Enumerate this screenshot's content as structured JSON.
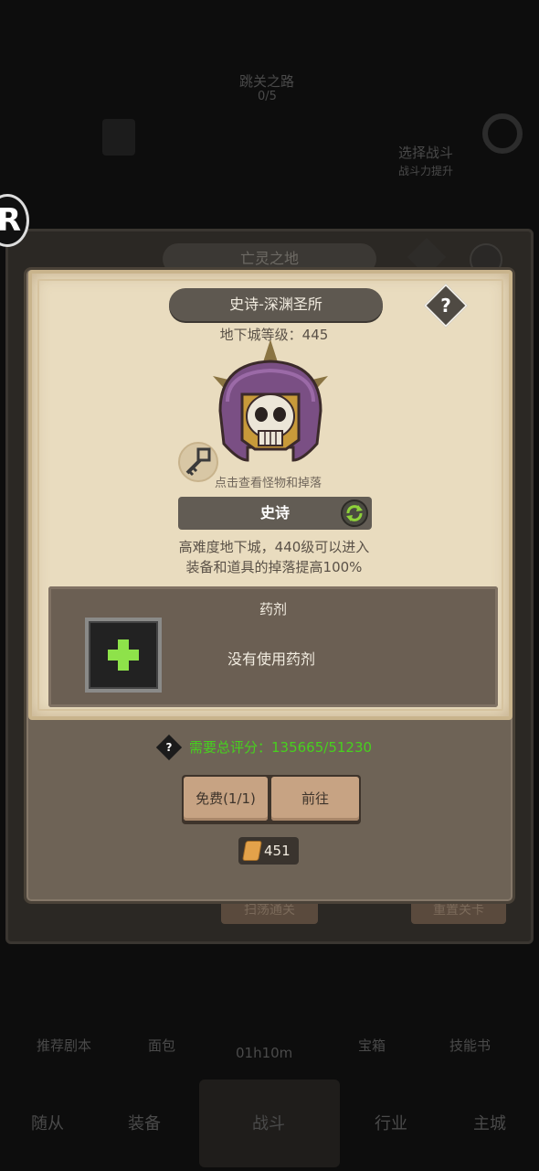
{
  "background": {
    "top_label": "跳关之路",
    "top_count": "0/5",
    "right_label": "选择战斗",
    "right_sub": "战斗力提升",
    "behind_title": "亡灵之地",
    "behind_btn_left": "扫荡通关",
    "behind_btn_right": "重置关卡",
    "timer": "01h10m",
    "nav": [
      "推荐剧本",
      "面包",
      "宝箱",
      "技能书"
    ],
    "tabs": [
      "随从",
      "装备",
      "战斗",
      "行业",
      "主城"
    ],
    "badge": "R"
  },
  "dialog": {
    "title": "史诗-深渊圣所",
    "help_label": "?",
    "level_text": "地下城等级：445",
    "monster_hint": "点击查看怪物和掉落",
    "rarity_label": "史诗",
    "desc_line1": "高难度地下城，440级可以进入",
    "desc_line2": "装备和道具的掉落提高100%",
    "potion": {
      "title": "药剂",
      "empty_text": "没有使用药剂"
    },
    "score": {
      "q": "?",
      "text": "需要总评分：135665/51230"
    },
    "buttons": {
      "free": "免费(1/1)",
      "go": "前往"
    },
    "cost": "451"
  },
  "colors": {
    "parchment": "#e9dcbf",
    "score_green": "#47d11e",
    "plus_green": "#8ee24a"
  }
}
